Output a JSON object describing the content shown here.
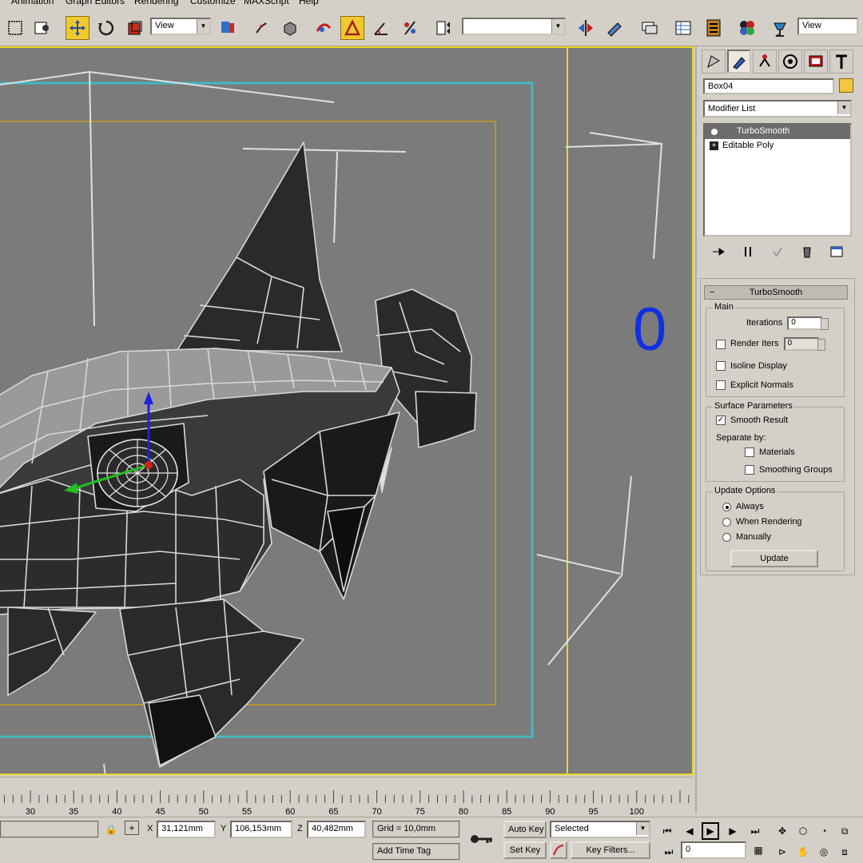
{
  "menu": {
    "items": [
      "Animation",
      "Graph Editors",
      "Rendering",
      "Customize",
      "MAXScript",
      "Help"
    ]
  },
  "toolbar": {
    "ref_coord_value": "View",
    "named_selection_value": "",
    "right_view_value": "View",
    "icons": [
      "select-object-icon",
      "select-by-name-icon",
      "move-icon",
      "rotate-icon",
      "scale-icon",
      "ref-coord-dropdown",
      "pivot-icon",
      "link-icon",
      "unlink-icon",
      "bind-spacewarp-icon",
      "snap-toggle-icon",
      "angle-snap-icon",
      "percent-snap-icon",
      "spinner-snap-icon",
      "edit-named-selection-icon",
      "named-selection-dropdown",
      "mirror-icon",
      "align-icon",
      "layer-manager-icon",
      "curve-editor-icon",
      "schematic-view-icon",
      "material-editor-icon",
      "render-scene-icon",
      "quick-render-icon"
    ]
  },
  "viewport": {
    "label_zero": "0",
    "background": "#7b7b7b",
    "safe_frame_color": "#44b8c0",
    "title_safe_color": "#c8a020",
    "border_color": "#e8d820",
    "label_color": "#1030e0"
  },
  "command_panel": {
    "tabs": [
      "create-tab",
      "modify-tab",
      "hierarchy-tab",
      "motion-tab",
      "display-tab",
      "utilities-tab"
    ],
    "object_name": "Box04",
    "object_color": "#f0c840",
    "modifier_list_label": "Modifier List",
    "stack": [
      {
        "label": "TurboSmooth",
        "selected": true,
        "kind": "bullet"
      },
      {
        "label": "Editable Poly",
        "selected": false,
        "kind": "plus"
      }
    ],
    "rollout_title": "TurboSmooth",
    "main": {
      "title": "Main",
      "iterations_label": "Iterations",
      "iterations_value": "0",
      "render_iters_label": "Render Iters",
      "render_iters_value": "0",
      "render_iters_checked": false,
      "isoline_label": "Isoline Display",
      "isoline_checked": false,
      "explicit_label": "Explicit Normals",
      "explicit_checked": false
    },
    "surface": {
      "title": "Surface Parameters",
      "smooth_result_label": "Smooth Result",
      "smooth_result_checked": true,
      "separate_by_label": "Separate by:",
      "materials_label": "Materials",
      "smoothing_groups_label": "Smoothing Groups"
    },
    "update_options": {
      "title": "Update Options",
      "always_label": "Always",
      "when_rendering_label": "When Rendering",
      "manually_label": "Manually",
      "selected": "always",
      "update_button": "Update"
    }
  },
  "timeline": {
    "ticks": [
      "30",
      "35",
      "40",
      "45",
      "50",
      "55",
      "60",
      "65",
      "70",
      "75",
      "80",
      "85",
      "90",
      "95",
      "100"
    ]
  },
  "status": {
    "x_label": "X",
    "x_value": "31,121mm",
    "y_label": "Y",
    "y_value": "106,153mm",
    "z_label": "Z",
    "z_value": "40,482mm",
    "grid_label": "Grid = 10,0mm",
    "add_time_tag": "Add Time Tag",
    "auto_key": "Auto Key",
    "set_key": "Set Key",
    "selected_value": "Selected",
    "key_filters": "Key Filters...",
    "frame_value": "0"
  }
}
